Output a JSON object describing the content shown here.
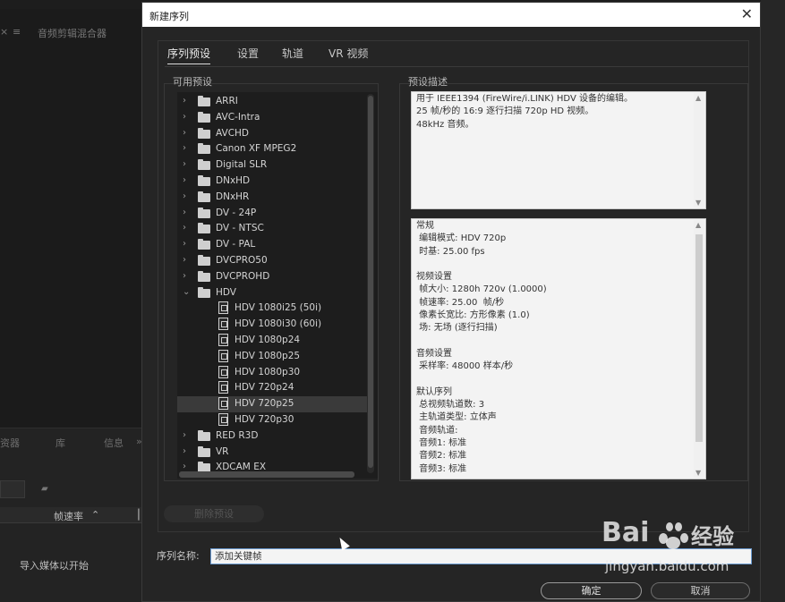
{
  "background": {
    "panel_title": "音频剪辑混合器",
    "close_glyph": "×",
    "menu_glyph": "≡",
    "lower_tabs": [
      "资器",
      "库",
      "信息"
    ],
    "lower_more": "»",
    "col_header": "帧速率",
    "col_sort": "⌃",
    "col_trail": "⎮",
    "import_text": "导入媒体以开始"
  },
  "dialog": {
    "title": "新建序列",
    "close_glyph": "✕",
    "tabs": [
      "序列预设",
      "设置",
      "轨道",
      "VR 视频"
    ],
    "available_presets_label": "可用预设",
    "preset_desc_label": "预设描述",
    "presets": [
      {
        "type": "folder",
        "label": "ARRI",
        "expanded": false
      },
      {
        "type": "folder",
        "label": "AVC-Intra",
        "expanded": false
      },
      {
        "type": "folder",
        "label": "AVCHD",
        "expanded": false
      },
      {
        "type": "folder",
        "label": "Canon XF MPEG2",
        "expanded": false
      },
      {
        "type": "folder",
        "label": "Digital SLR",
        "expanded": false
      },
      {
        "type": "folder",
        "label": "DNxHD",
        "expanded": false
      },
      {
        "type": "folder",
        "label": "DNxHR",
        "expanded": false
      },
      {
        "type": "folder",
        "label": "DV - 24P",
        "expanded": false
      },
      {
        "type": "folder",
        "label": "DV - NTSC",
        "expanded": false
      },
      {
        "type": "folder",
        "label": "DV - PAL",
        "expanded": false
      },
      {
        "type": "folder",
        "label": "DVCPRO50",
        "expanded": false
      },
      {
        "type": "folder",
        "label": "DVCPROHD",
        "expanded": false
      },
      {
        "type": "folder",
        "label": "HDV",
        "expanded": true
      },
      {
        "type": "file",
        "label": "HDV 1080i25 (50i)"
      },
      {
        "type": "file",
        "label": "HDV 1080i30 (60i)"
      },
      {
        "type": "file",
        "label": "HDV 1080p24"
      },
      {
        "type": "file",
        "label": "HDV 1080p25"
      },
      {
        "type": "file",
        "label": "HDV 1080p30"
      },
      {
        "type": "file",
        "label": "HDV 720p24"
      },
      {
        "type": "file",
        "label": "HDV 720p25",
        "selected": true
      },
      {
        "type": "file",
        "label": "HDV 720p30"
      },
      {
        "type": "folder",
        "label": "RED R3D",
        "expanded": false
      },
      {
        "type": "folder",
        "label": "VR",
        "expanded": false
      },
      {
        "type": "folder",
        "label": "XDCAM EX",
        "expanded": false
      }
    ],
    "description": "用于 IEEE1394 (FireWire/i.LINK) HDV 设备的编辑。\n25 帧/秒的 16:9 逐行扫描 720p HD 视频。\n48kHz 音频。",
    "details": "常规\n 编辑模式: HDV 720p\n 时基: 25.00 fps\n\n视频设置\n 帧大小: 1280h 720v (1.0000)\n 帧速率: 25.00  帧/秒\n 像素长宽比: 方形像素 (1.0)\n 场: 无场 (逐行扫描)\n\n音频设置\n 采样率: 48000 样本/秒\n\n默认序列\n 总视频轨道数: 3\n 主轨道类型: 立体声\n 音频轨道:\n 音频1: 标准\n 音频2: 标准\n 音频3: 标准",
    "delete_preset_label": "删除预设",
    "sequence_name_label": "序列名称:",
    "sequence_name_value": "添加关键帧",
    "ok_label": "确定",
    "cancel_label": "取消"
  },
  "watermark": {
    "logo": "Bai",
    "logo_tail": "经验",
    "url": "jingyan.baidu.com"
  }
}
